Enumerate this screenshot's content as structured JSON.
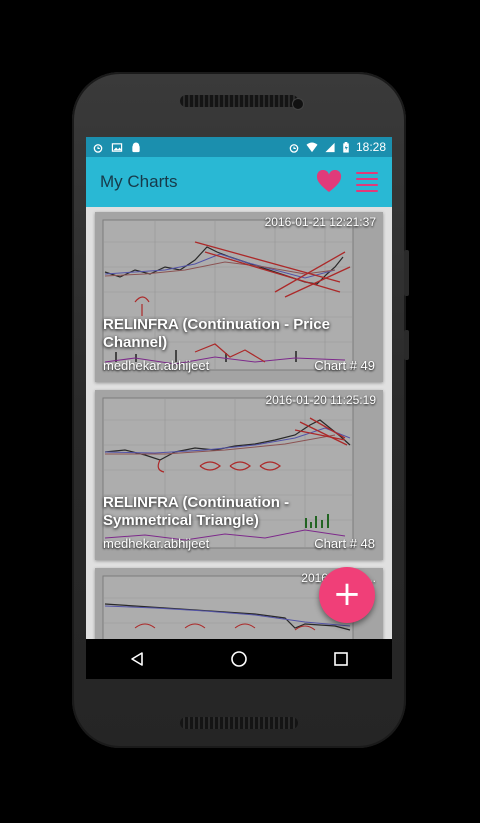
{
  "status_bar": {
    "time": "18:28"
  },
  "app_bar": {
    "title": "My Charts",
    "heart_icon": "favorite-icon",
    "menu_icon": "menu-icon"
  },
  "cards": [
    {
      "date": "2016-01-21 12:21:37",
      "title": "RELINFRA (Continuation - Price Channel)",
      "author": "medhekar.abhijeet",
      "chart_no": "Chart # 49"
    },
    {
      "date": "2016-01-20 11:25:19",
      "title": "RELINFRA (Continuation - Symmetrical Triangle)",
      "author": "medhekar.abhijeet",
      "chart_no": "Chart # 48"
    },
    {
      "date": "2016-01-19 ..."
    }
  ],
  "fab": {
    "label": "+"
  },
  "colors": {
    "status_bar": "#1b8fae",
    "app_bar": "#29b8d4",
    "accent": "#f03f78"
  }
}
